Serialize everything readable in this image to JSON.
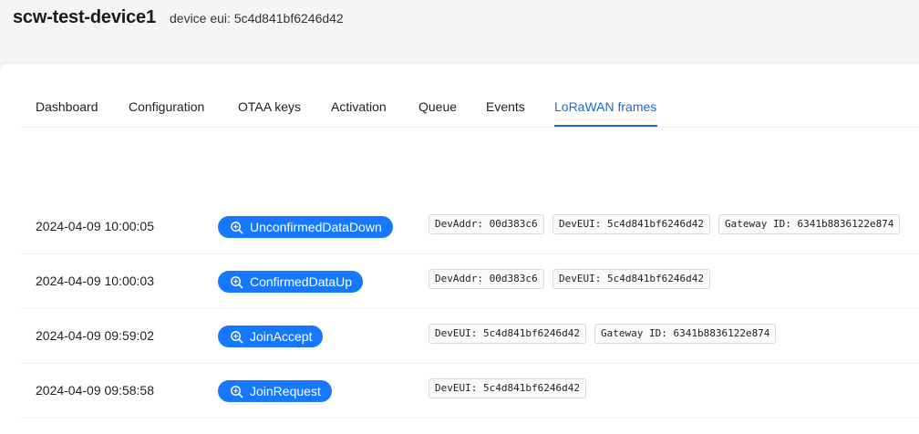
{
  "header": {
    "device_name": "scw-test-device1",
    "device_eui_label": "device eui: 5c4d841bf6246d42"
  },
  "tabs": [
    {
      "label": "Dashboard",
      "active": false
    },
    {
      "label": "Configuration",
      "active": false
    },
    {
      "label": "OTAA keys",
      "active": false
    },
    {
      "label": "Activation",
      "active": false
    },
    {
      "label": "Queue",
      "active": false
    },
    {
      "label": "Events",
      "active": false
    },
    {
      "label": "LoRaWAN frames",
      "active": true
    }
  ],
  "frames": [
    {
      "time": "2024-04-09 10:00:05",
      "type": "UnconfirmedDataDown",
      "tags": [
        "DevAddr: 00d383c6",
        "DevEUI: 5c4d841bf6246d42",
        "Gateway ID: 6341b8836122e874"
      ]
    },
    {
      "time": "2024-04-09 10:00:03",
      "type": "ConfirmedDataUp",
      "tags": [
        "DevAddr: 00d383c6",
        "DevEUI: 5c4d841bf6246d42"
      ]
    },
    {
      "time": "2024-04-09 09:59:02",
      "type": "JoinAccept",
      "tags": [
        "DevEUI: 5c4d841bf6246d42",
        "Gateway ID: 6341b8836122e874"
      ]
    },
    {
      "time": "2024-04-09 09:58:58",
      "type": "JoinRequest",
      "tags": [
        "DevEUI: 5c4d841bf6246d42"
      ]
    }
  ],
  "icons": {
    "frame_button_icon": "zoom-in-icon"
  },
  "colors": {
    "accent": "#1677ff",
    "active_tab": "#1668dc",
    "page_background": "#f5f5f5"
  }
}
